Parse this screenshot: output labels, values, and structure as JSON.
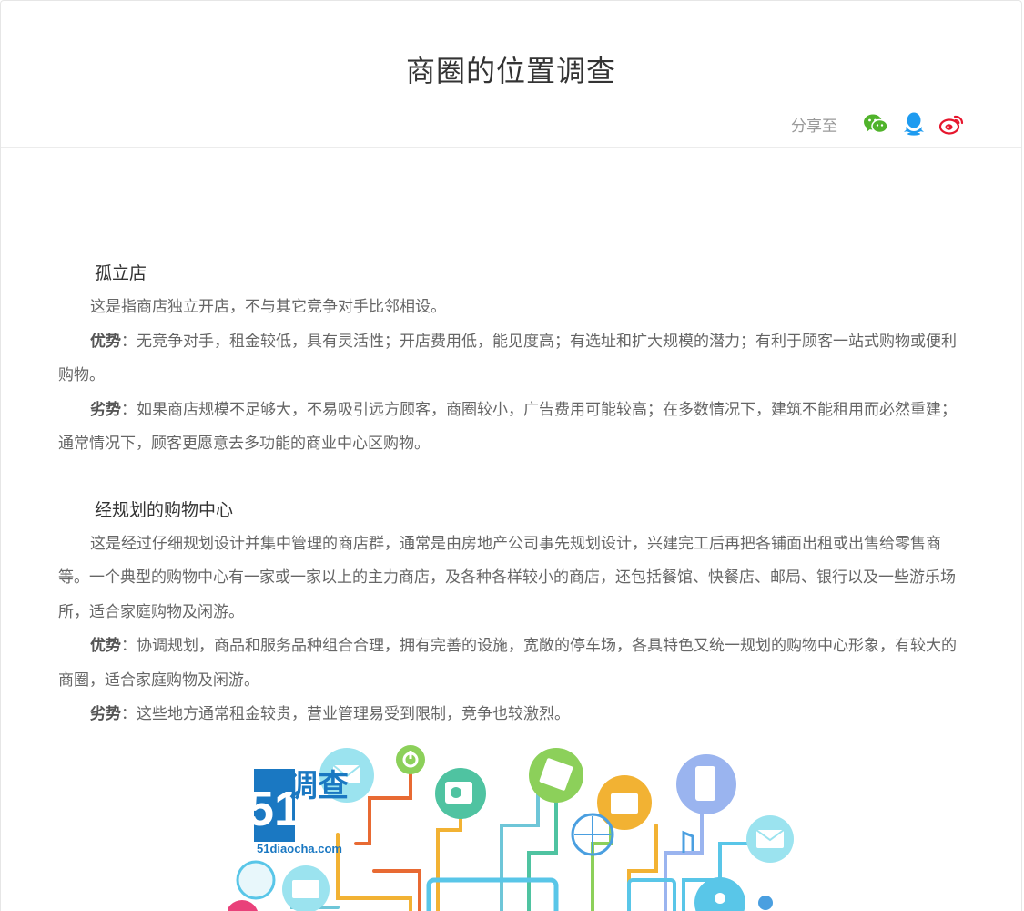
{
  "page": {
    "title": "商圈的位置调查",
    "share_label": "分享至"
  },
  "share_icons": [
    "wechat-icon",
    "qq-icon",
    "weibo-icon"
  ],
  "colors": {
    "wechat": "#50b32b",
    "qq": "#1e9bf0",
    "weibo": "#e6162d"
  },
  "sections": [
    {
      "title": "孤立店",
      "intro": "这是指商店独立开店，不与其它竞争对手比邻相设。",
      "adv_label": "优势",
      "adv_text": "：无竞争对手，租金较低，具有灵活性；开店费用低，能见度高；有选址和扩大规模的潜力；有利于顾客一站式购物或便利购物。",
      "dis_label": "劣势",
      "dis_text": "：如果商店规模不足够大，不易吸引远方顾客，商圈较小，广告费用可能较高；在多数情况下，建筑不能租用而必然重建；通常情况下，顾客更愿意去多功能的商业中心区购物。"
    },
    {
      "title": "经规划的购物中心",
      "intro": "这是经过仔细规划设计并集中管理的商店群，通常是由房地产公司事先规划设计，兴建完工后再把各铺面出租或出售给零售商等。一个典型的购物中心有一家或一家以上的主力商店，及各种各样较小的商店，还包括餐馆、快餐店、邮局、银行以及一些游乐场所，适合家庭购物及闲游。",
      "adv_label": "优势",
      "adv_text": "：协调规划，商品和服务品种组合合理，拥有完善的设施，宽敞的停车场，各具特色又统一规划的购物中心形象，有较大的商圈，适合家庭购物及闲游。",
      "dis_label": "劣势",
      "dis_text": "：这些地方通常租金较贵，营业管理易受到限制，竞争也较激烈。"
    }
  ],
  "logo": {
    "number": "51",
    "chars": "调查",
    "site": "51diaocha.com"
  }
}
